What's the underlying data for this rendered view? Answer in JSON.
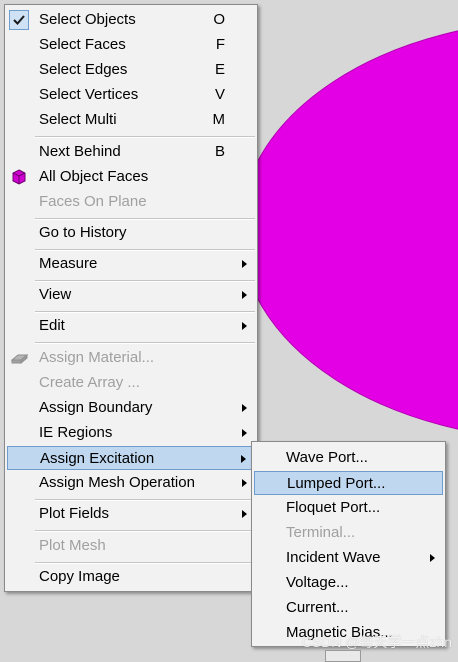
{
  "colors": {
    "background": "#d7d7d7",
    "object": "#e400e4",
    "menu_bg": "#f2f2f2",
    "highlight": "#bfd7ef"
  },
  "main_menu": {
    "items": [
      {
        "label": "Select Objects",
        "shortcut": "O",
        "checked": true
      },
      {
        "label": "Select Faces",
        "shortcut": "F"
      },
      {
        "label": "Select Edges",
        "shortcut": "E"
      },
      {
        "label": "Select Vertices",
        "shortcut": "V"
      },
      {
        "label": "Select Multi",
        "shortcut": "M"
      },
      {
        "label": "Next Behind",
        "shortcut": "B"
      },
      {
        "label": "All Object Faces",
        "icon": "cube-icon"
      },
      {
        "label": "Faces On Plane",
        "disabled": true
      },
      {
        "label": "Go to History"
      },
      {
        "label": "Measure",
        "submenu": true
      },
      {
        "label": "View",
        "submenu": true
      },
      {
        "label": "Edit",
        "submenu": true
      },
      {
        "label": "Assign Material...",
        "disabled": true,
        "icon": "material-icon"
      },
      {
        "label": "Create Array ...",
        "disabled": true
      },
      {
        "label": "Assign Boundary",
        "submenu": true
      },
      {
        "label": "IE Regions",
        "submenu": true
      },
      {
        "label": "Assign Excitation",
        "submenu": true,
        "highlighted": true
      },
      {
        "label": "Assign Mesh Operation",
        "submenu": true
      },
      {
        "label": "Plot Fields",
        "submenu": true
      },
      {
        "label": "Plot Mesh",
        "disabled": true
      },
      {
        "label": "Copy Image"
      }
    ]
  },
  "sub_menu": {
    "items": [
      {
        "label": "Wave Port..."
      },
      {
        "label": "Lumped Port...",
        "highlighted": true
      },
      {
        "label": "Floquet Port..."
      },
      {
        "label": "Terminal...",
        "disabled": true
      },
      {
        "label": "Incident Wave",
        "submenu": true
      },
      {
        "label": "Voltage..."
      },
      {
        "label": "Current..."
      },
      {
        "label": "Magnetic Bias..."
      }
    ]
  },
  "watermark": "CSDN @每天学一点zhn"
}
